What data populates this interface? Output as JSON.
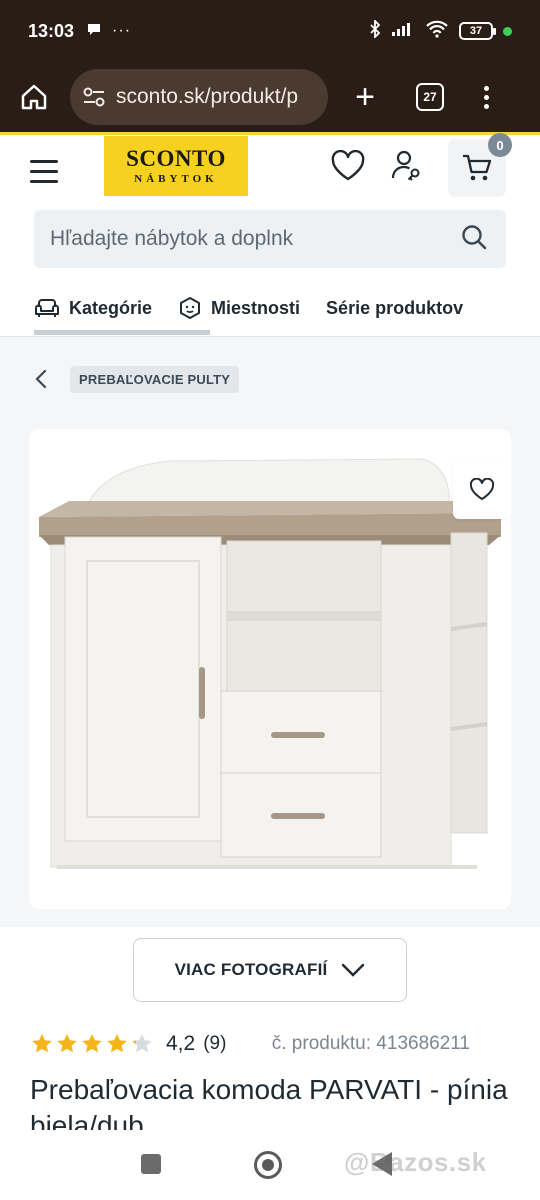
{
  "status_bar": {
    "time": "13:03",
    "battery": "37"
  },
  "browser": {
    "url": "sconto.sk/produkt/p",
    "tab_count": "27"
  },
  "site": {
    "logo_line1": "SCONTO",
    "logo_line2": "NÁBYTOK",
    "cart_count": "0"
  },
  "search": {
    "placeholder": "Hľadajte nábytok a doplnk"
  },
  "nav": {
    "tabs": [
      {
        "label": "Kategórie"
      },
      {
        "label": "Miestnosti"
      },
      {
        "label": "Série produktov"
      }
    ]
  },
  "breadcrumb": {
    "label": "PREBAĽOVACIE PULTY"
  },
  "gallery": {
    "more_photos_label": "VIAC FOTOGRAFIÍ"
  },
  "product": {
    "rating": "4,2",
    "rating_count": "(9)",
    "rating_stars_filled": 4.2,
    "rating_stars_max": 5,
    "code": "č. produktu: 413686211",
    "title": "Prebaľovacia komoda PARVATI - pínia biela/dub"
  },
  "watermark": "@Bazos.sk",
  "colors": {
    "brand_yellow": "#f6d11f",
    "browser_bg": "#2a1d16",
    "star": "#f5b41c"
  }
}
